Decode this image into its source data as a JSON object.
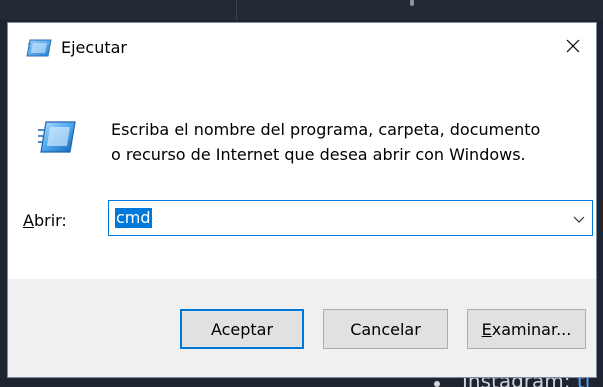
{
  "background": {
    "partial_text_bullet": "•",
    "partial_text": "Instagram:",
    "partial_link": "ti"
  },
  "dialog": {
    "title": "Ejecutar",
    "close_glyph": "✕",
    "description_line1": "Escriba el nombre del programa, carpeta, documento",
    "description_line2": "o recurso de Internet que desea abrir con Windows.",
    "open_label_access_key": "A",
    "open_label_rest": "brir:",
    "command_value": "cmd",
    "dropdown_glyph": "⌵"
  },
  "buttons": {
    "ok": "Aceptar",
    "cancel": "Cancelar",
    "browse_access_key": "E",
    "browse_rest": "xaminar..."
  },
  "colors": {
    "accent": "#0078d7",
    "footer_bg": "#f0f0f0",
    "button_bg": "#e1e1e1"
  }
}
